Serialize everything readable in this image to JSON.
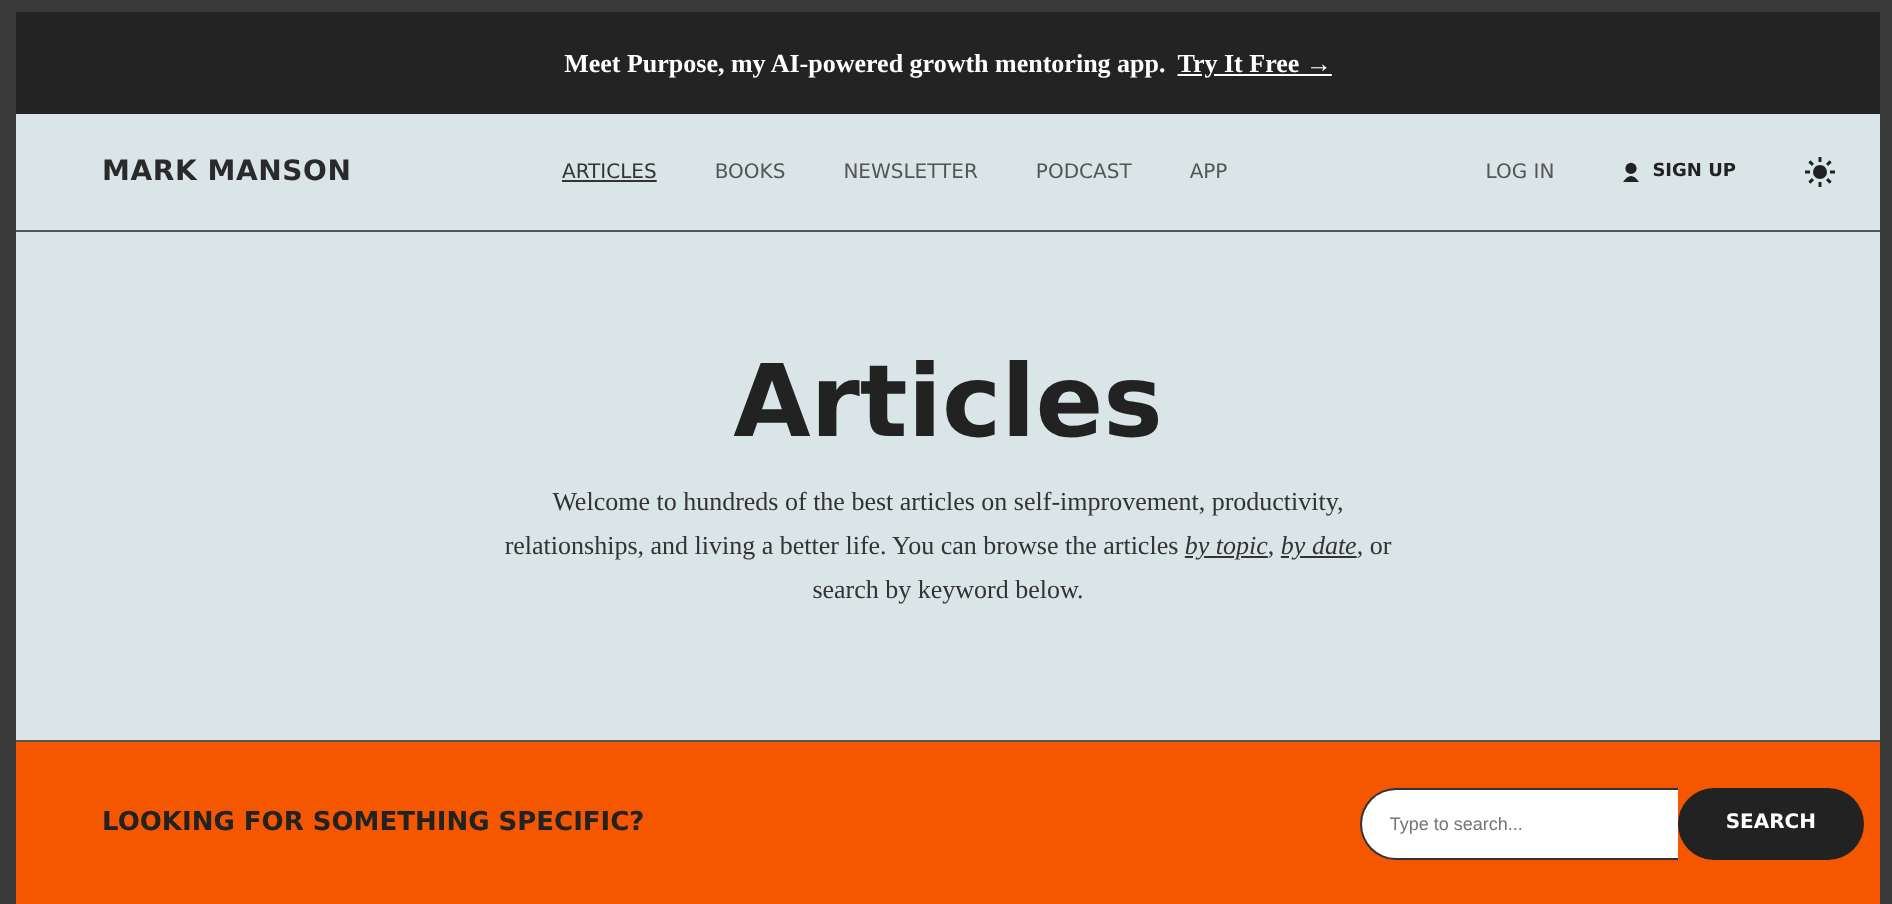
{
  "announcement": {
    "text": "Meet Purpose, my AI-powered growth mentoring app.",
    "link": "Try It Free →"
  },
  "header": {
    "logo": "MARK MANSON",
    "nav": [
      {
        "label": "ARTICLES",
        "selected": true
      },
      {
        "label": "BOOKS",
        "selected": false
      },
      {
        "label": "NEWSLETTER",
        "selected": false
      },
      {
        "label": "PODCAST",
        "selected": false
      },
      {
        "label": "APP",
        "selected": false
      }
    ],
    "login": "LOG IN",
    "signup": "SIGN UP"
  },
  "hero": {
    "title": "Articles",
    "intro": [
      {
        "kind": "text",
        "text": "Welcome to hundreds of the best articles on self-improvement, productivity, relationships, and living a better life. You can browse the articles "
      },
      {
        "kind": "link",
        "text": "by topic"
      },
      {
        "kind": "text",
        "text": ", "
      },
      {
        "kind": "link",
        "text": "by date"
      },
      {
        "kind": "text",
        "text": ", or search by keyword below."
      }
    ]
  },
  "search_band": {
    "heading": "LOOKING FOR SOMETHING SPECIFIC?",
    "placeholder": "Type to search...",
    "button": "SEARCH"
  }
}
